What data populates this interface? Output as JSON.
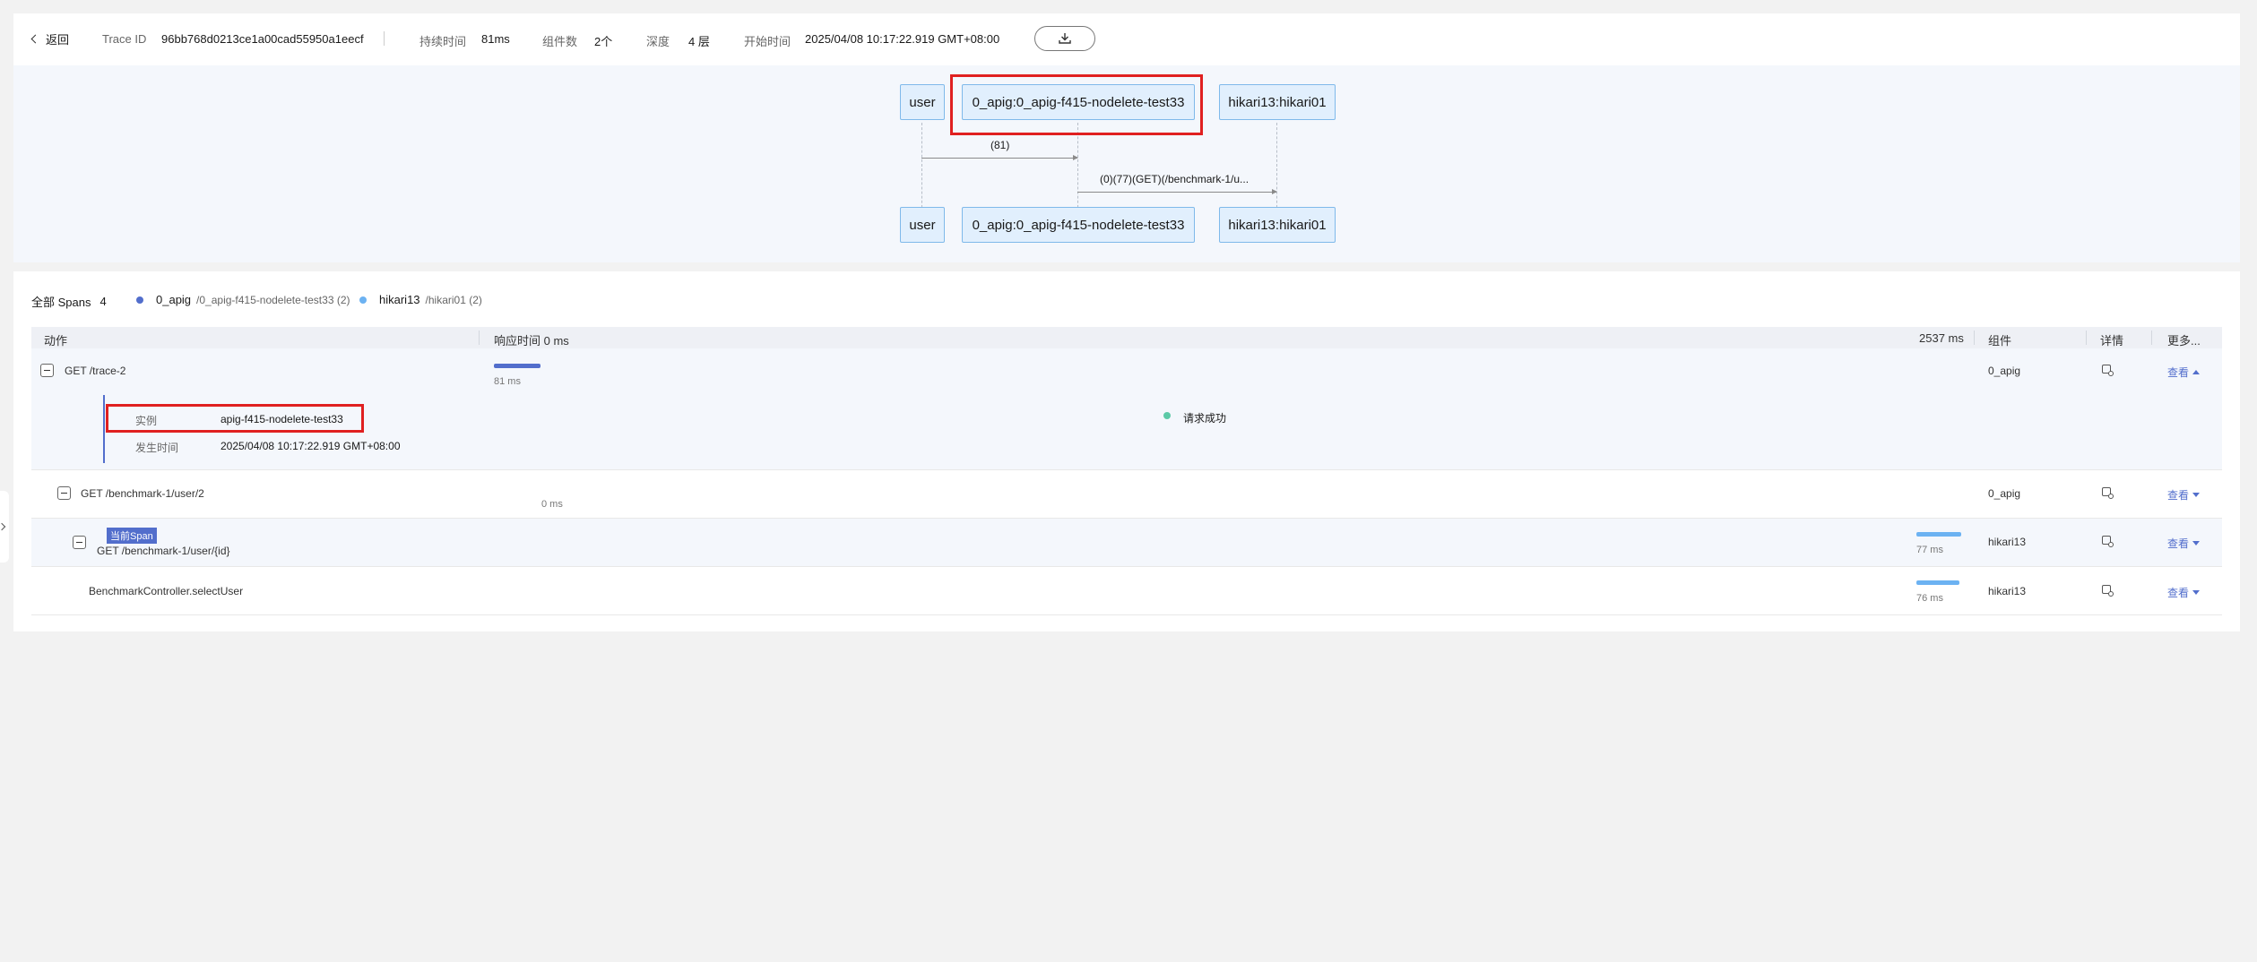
{
  "header": {
    "back_label": "返回",
    "trace_id_label": "Trace ID",
    "trace_id": "96bb768d0213ce1a00cad55950a1eecf",
    "duration_label": "持续时间",
    "duration": "81ms",
    "components_label": "组件数",
    "components": "2个",
    "depth_label": "深度",
    "depth": "4 层",
    "start_label": "开始时间",
    "start_time": "2025/04/08 10:17:22.919 GMT+08:00"
  },
  "sequence": {
    "nodes": [
      "user",
      "0_apig:0_apig-f415-nodelete-test33",
      "hikari13:hikari01"
    ],
    "messages": [
      {
        "label": "(81)"
      },
      {
        "label": "(0)(77)(GET)(/benchmark-1/u..."
      }
    ]
  },
  "spans": {
    "all_label": "全部 Spans",
    "all_count": "4",
    "legend": [
      {
        "name": "0_apig",
        "detail": "/0_apig-f415-nodelete-test33 (2)",
        "color": "#526ecc"
      },
      {
        "name": "hikari13",
        "detail": "/hikari01 (2)",
        "color": "#6cb2f2"
      }
    ],
    "columns": {
      "action": "动作",
      "response": "响应时间 0 ms",
      "max": "2537 ms",
      "component": "组件",
      "detail": "详情",
      "more": "更多..."
    },
    "rows": [
      {
        "action": "GET /trace-2",
        "bar_label": "81 ms",
        "component": "0_apig",
        "view": "查看",
        "progress": 0.032
      },
      {
        "action": "GET /benchmark-1/user/2",
        "bar_label": "0 ms",
        "component": "0_apig",
        "view": "查看",
        "progress": 0
      },
      {
        "badge": "当前Span",
        "action": "GET /benchmark-1/user/{id}",
        "bar_label": "77 ms",
        "component": "hikari13",
        "view": "查看",
        "progress": 0.03
      },
      {
        "action": "BenchmarkController.selectUser",
        "bar_label": "76 ms",
        "component": "hikari13",
        "view": "查看",
        "progress": 0.03
      }
    ],
    "expanded": {
      "instance_label": "实例",
      "instance": "apig-f415-nodelete-test33",
      "time_label": "发生时间",
      "time": "2025/04/08 10:17:22.919 GMT+08:00",
      "status": "请求成功",
      "status_color": "#5cc9a7"
    }
  }
}
